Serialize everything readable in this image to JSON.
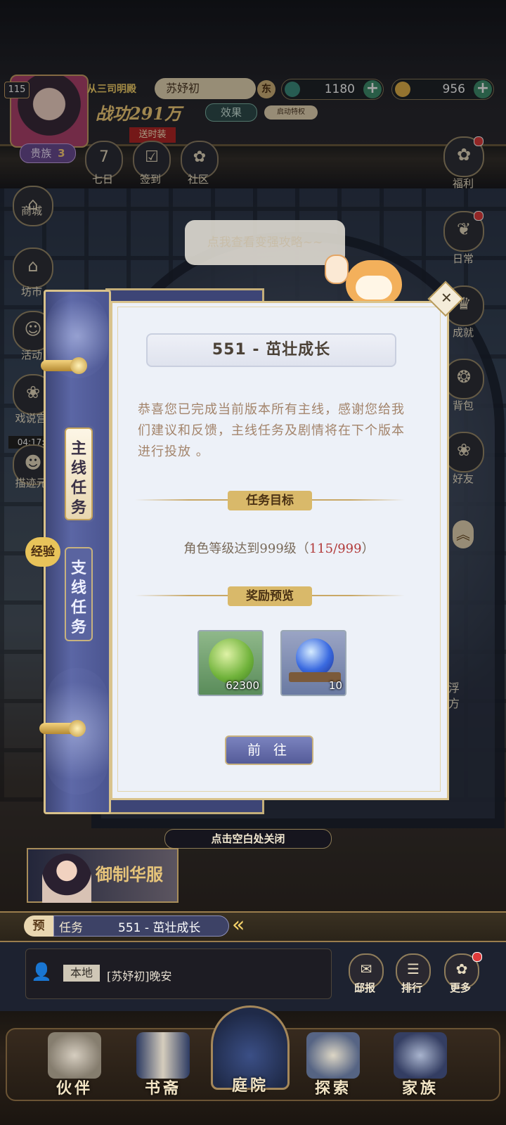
{
  "player": {
    "level": "115",
    "rank_title": "从三司明殿",
    "name": "苏妤初",
    "server_badge": "东",
    "power": "战功291万",
    "effect_button": "效果",
    "privilege_button": "启动特权",
    "gift_tag": "送时装",
    "noble": "贵族",
    "noble_level": "3"
  },
  "currencies": [
    {
      "icon": "jade-swirl-icon",
      "value": "1180",
      "plus": "+"
    },
    {
      "icon": "gold-ingot-icon",
      "value": "956",
      "plus": "+"
    }
  ],
  "top_shortcuts": [
    {
      "icon": "calendar-seven-icon",
      "glyph": "7",
      "label": "七日"
    },
    {
      "icon": "checkin-calendar-icon",
      "glyph": "☑",
      "label": "签到"
    },
    {
      "icon": "community-flower-icon",
      "glyph": "✿",
      "label": "社区"
    }
  ],
  "left_menu": [
    {
      "icon": "shop-building-icon",
      "glyph": "⌂",
      "label": "商城"
    },
    {
      "icon": "market-building-icon",
      "glyph": "⌂",
      "label": "坊市"
    },
    {
      "icon": "activity-icon",
      "glyph": "☺",
      "label": "活动"
    },
    {
      "icon": "opera-palace-icon",
      "glyph": "❀",
      "label": "戏说宫"
    },
    {
      "icon": "event-timer-icon",
      "glyph": "☻",
      "label": "描迹元",
      "timer": "04:17:"
    }
  ],
  "right_menu": [
    {
      "icon": "welfare-gift-icon",
      "glyph": "✿",
      "label": "福利"
    },
    {
      "icon": "daily-scroll-icon",
      "glyph": "❦",
      "label": "日常"
    },
    {
      "icon": "achievement-cup-icon",
      "glyph": "♛",
      "label": "成就"
    },
    {
      "icon": "backpack-icon",
      "glyph": "❂",
      "label": "背包"
    },
    {
      "icon": "friends-icon",
      "glyph": "❀",
      "label": "好友"
    }
  ],
  "tip_bubble": "点我查看变强攻略~~",
  "side_text": "浮\n方",
  "quest_panel": {
    "tabs": [
      {
        "label": "主线\n任务"
      },
      {
        "label": "支线\n任务"
      }
    ],
    "exp_badge": "经验",
    "title": "551 - 茁壮成长",
    "description": "恭喜您已完成当前版本所有主线，感谢您给我们建议和反馈，主线任务及剧情将在下个版本进行投放 。",
    "goal_header": "任务目标",
    "goal_text": "角色等级达到999级（",
    "goal_progress": "115/999",
    "goal_suffix": "）",
    "reward_header": "奖励预览",
    "rewards": [
      {
        "icon": "green-leaf-orb-icon",
        "count": "62300"
      },
      {
        "icon": "blue-crystal-ball-icon",
        "count": "10"
      }
    ],
    "go_button": "前 往",
    "close_symbol": "✕"
  },
  "tap_to_close": "点击空白处关闭",
  "promo": {
    "text": "御制华服"
  },
  "task_bar": {
    "tag": "预",
    "type": "任务",
    "name": "551 - 茁壮成长",
    "arrow": "«"
  },
  "chat": {
    "channel": "本地",
    "message": "[苏妤初]晚安"
  },
  "mini_buttons": [
    {
      "icon": "mail-report-icon",
      "glyph": "✉",
      "label": "邸报"
    },
    {
      "icon": "ranking-icon",
      "glyph": "☰",
      "label": "排行"
    },
    {
      "icon": "more-flower-icon",
      "glyph": "✿",
      "label": "更多"
    }
  ],
  "bottom_nav": [
    {
      "icon": "teapot-partner-icon",
      "label": "伙伴"
    },
    {
      "icon": "books-study-icon",
      "label": "书斋"
    },
    {
      "icon": "courtyard-pavilion-icon",
      "label": "庭院"
    },
    {
      "icon": "explore-brush-icon",
      "label": "探索"
    },
    {
      "icon": "family-pavilion-icon",
      "label": "家族"
    }
  ],
  "colors": {
    "dialog_bg": "#edf1f8",
    "gold_accent": "#d9b96a",
    "scroll_purple": "#5b66a5",
    "progress_red": "#b23a3a"
  }
}
